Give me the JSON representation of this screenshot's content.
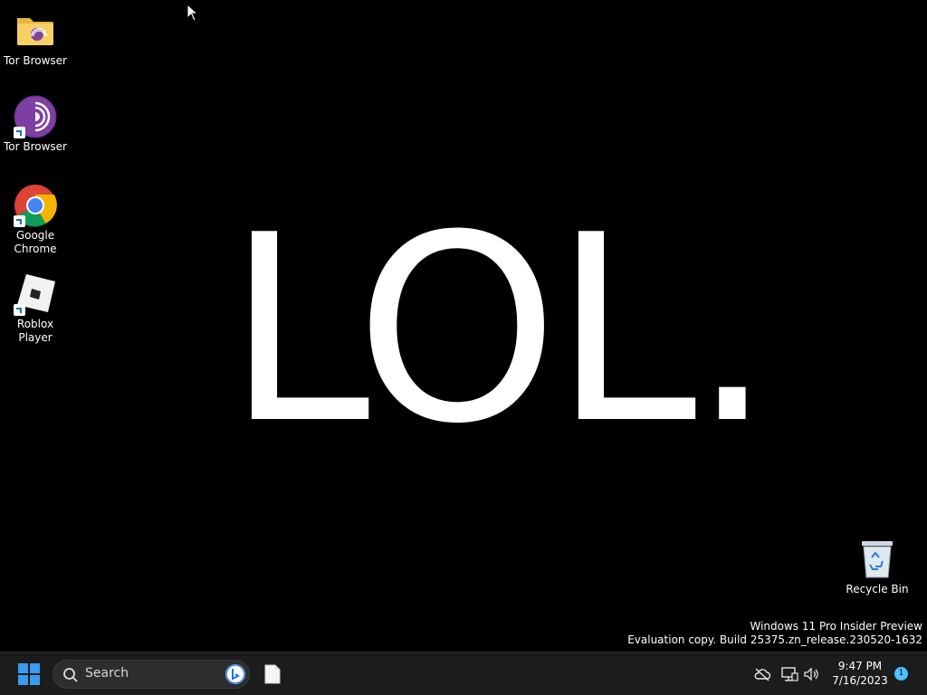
{
  "wallpaper": {
    "text": "LOL."
  },
  "desktop_icons": [
    {
      "label": "Tor Browser",
      "icon": "folder-icon",
      "shortcut": false
    },
    {
      "label": "Tor Browser",
      "icon": "tor-browser-icon",
      "shortcut": true
    },
    {
      "label": "Google Chrome",
      "icon": "chrome-icon",
      "shortcut": true
    },
    {
      "label": "Roblox Player",
      "icon": "roblox-icon",
      "shortcut": true
    }
  ],
  "recycle_bin": {
    "label": "Recycle Bin",
    "icon": "recycle-bin-icon"
  },
  "watermark": {
    "line1": "Windows 11 Pro Insider Preview",
    "line2": "Evaluation copy. Build 25375.zn_release.230520-1632"
  },
  "taskbar": {
    "start_icon": "windows-start-icon",
    "search": {
      "placeholder": "Search",
      "icon": "search-icon",
      "bing_icon": "bing-icon"
    },
    "pinned_apps": [
      {
        "icon": "document-icon"
      }
    ],
    "tray": {
      "icons": [
        "cloud-off-icon",
        "network-icon",
        "volume-icon"
      ],
      "time": "9:47 PM",
      "date": "7/16/2023",
      "notification_count": "1"
    }
  },
  "colors": {
    "background": "#000000",
    "taskbar": "#1c1c1c",
    "accent": "#4cc2ff"
  }
}
